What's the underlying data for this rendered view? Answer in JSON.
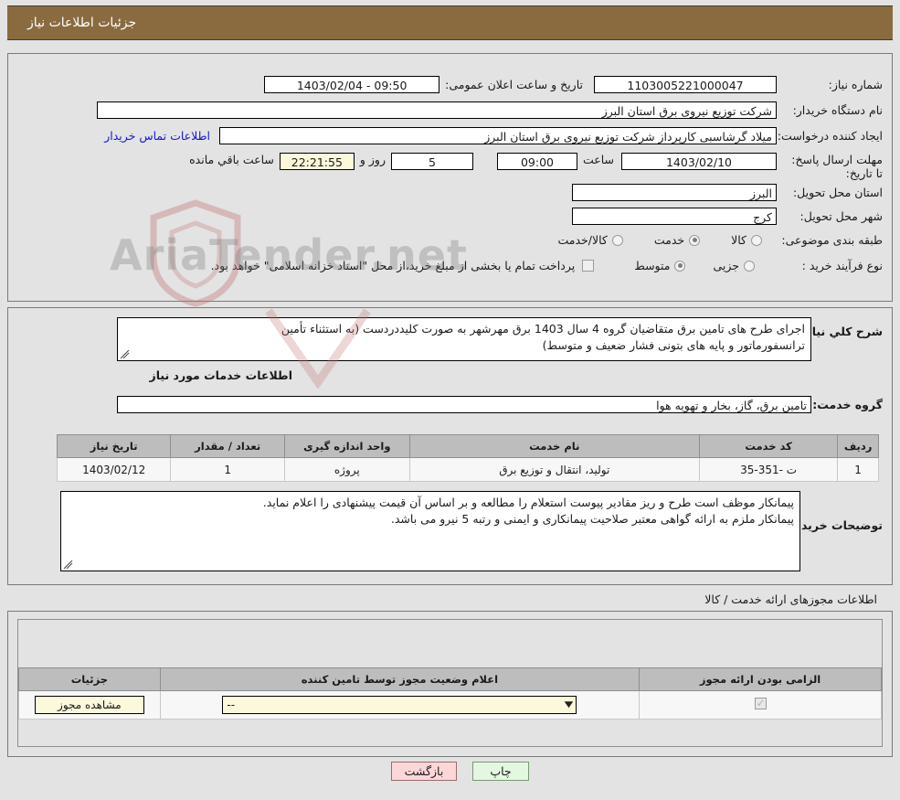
{
  "header": {
    "title": "جزئیات اطلاعات نیاز"
  },
  "watermark": {
    "text": "AriaTender.net"
  },
  "top_form": {
    "need_number_label": "شماره نیاز:",
    "need_number_value": "1103005221000047",
    "public_announce_label": "تاریخ و ساعت اعلان عمومی:",
    "public_announce_value": "09:50 - 1403/02/04",
    "buyer_org_label": "نام دستگاه خریدار:",
    "buyer_org_value": "شرکت توزیع نیروی برق استان البرز",
    "requester_label": "ایجاد کننده درخواست:",
    "requester_value": "میلاد گرشاسبی کارپرداز شرکت توزیع نیروی برق استان البرز",
    "requester_value_short": "شرکت توزیع نیروی برق استان البرز",
    "contact_link": "اطلاعات تماس خریدار",
    "deadline_label": "مهلت ارسال پاسخ: تا تاریخ:",
    "deadline_date": "1403/02/10",
    "deadline_hour_label": "ساعت",
    "deadline_hour": "09:00",
    "days_remaining": "5",
    "days_word": "روز و",
    "time_remaining": "22:21:55",
    "remaining_suffix": "ساعت باقي مانده",
    "province_label": "استان محل تحویل:",
    "province_value": "البرز",
    "city_label": "شهر محل تحویل:",
    "city_value": "کرج",
    "category_label": "طبقه بندی موضوعی:",
    "category_options": [
      {
        "label": "کالا",
        "selected": false
      },
      {
        "label": "خدمت",
        "selected": true
      },
      {
        "label": "کالا/خدمت",
        "selected": false
      }
    ],
    "process_label": "نوع فرآیند خرید :",
    "process_options": [
      {
        "label": "جزیی",
        "selected": false
      },
      {
        "label": "متوسط",
        "selected": true
      }
    ],
    "payment_note": "پرداخت تمام یا بخشی از مبلغ خرید،از محل \"اسناد خزانه اسلامی\" خواهد بود.",
    "payment_checked": false
  },
  "summary": {
    "label": "شرح کلي نیاز:",
    "text_line1": "اجرای طرح های تامین برق متقاضیان گروه 4 سال 1403 برق مهرشهر به صورت کلیددردست (به استثناء تأمین",
    "text_line2": "ترانسفورماتور و پایه های بتونی فشار ضعیف و متوسط)"
  },
  "services_section": {
    "heading": "اطلاعات خدمات مورد نیاز",
    "group_label": "گروه خدمت:",
    "group_value": "تامین برق، گاز، بخار و تهویه هوا"
  },
  "services_table": {
    "columns": [
      "ردیف",
      "کد خدمت",
      "نام خدمت",
      "واحد اندازه گیری",
      "تعداد / مقدار",
      "تاریخ نیاز"
    ],
    "rows": [
      {
        "row": "1",
        "code": "ت -351-35",
        "name": "تولید، انتقال و توزیع برق",
        "unit": "پروژه",
        "qty": "1",
        "date": "1403/02/12"
      }
    ]
  },
  "buyer_notes": {
    "label": "توضیحات خریدار:",
    "line1": "پیمانکار موظف است طرح و ریز مقادیر پیوست استعلام را مطالعه و بر اساس آن قیمت پیشنهادی را اعلام نماید.",
    "line2": "پیمانکار ملزم به ارائه گواهی معتبر صلاحیت پیمانکاری و ایمنی و رتبه 5 نیرو می باشد."
  },
  "permits_section": {
    "heading": "اطلاعات مجوزهای ارائه خدمت / کالا",
    "columns": [
      "الزامی بودن ارائه مجوز",
      "اعلام وضعیت مجوز توسط تامین کننده",
      "جزئیات"
    ],
    "rows": [
      {
        "required": true,
        "status_value": "--",
        "details_label": "مشاهده مجوز"
      }
    ]
  },
  "footer": {
    "print_label": "چاپ",
    "back_label": "بازگشت"
  }
}
